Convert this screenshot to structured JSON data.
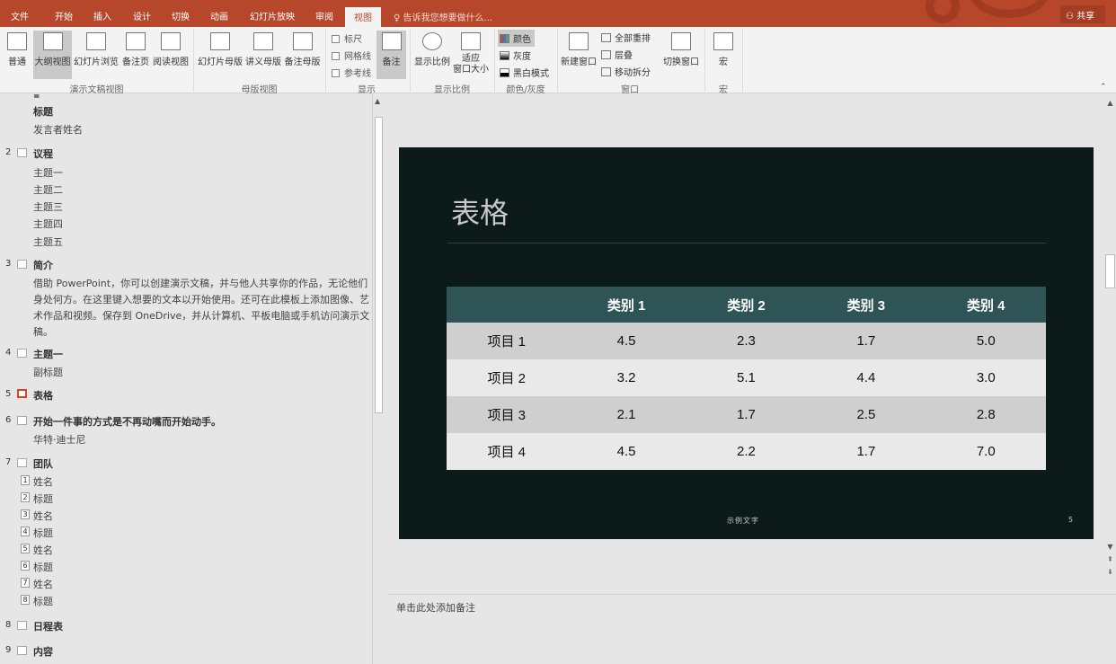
{
  "tabs": [
    "文件",
    "开始",
    "插入",
    "设计",
    "切换",
    "动画",
    "幻灯片放映",
    "审阅",
    "视图"
  ],
  "active_tab": "视图",
  "tell_me": "告诉我您想要做什么...",
  "share": "共享",
  "ribbon": {
    "presentation_views": {
      "normal": "普通",
      "outline": "大纲视图",
      "sorter": "幻灯片浏览",
      "notes_page": "备注页",
      "reading": "阅读视图",
      "group": "演示文稿视图"
    },
    "master_views": {
      "slide_master": "幻灯片母版",
      "handout_master": "讲义母版",
      "notes_master": "备注母版",
      "group": "母版视图"
    },
    "show": {
      "ruler": "标尺",
      "gridlines": "网格线",
      "guides": "参考线",
      "notes": "备注",
      "group": "显示"
    },
    "zoom": {
      "zoom": "显示比例",
      "fit_line1": "适应",
      "fit_line2": "窗口大小",
      "group": "显示比例"
    },
    "color": {
      "color": "颜色",
      "grayscale": "灰度",
      "bw": "黑白模式",
      "group": "颜色/灰度"
    },
    "window": {
      "new_window": "新建窗口",
      "arrange_all": "全部重排",
      "cascade": "层叠",
      "move_split": "移动拆分",
      "switch": "切换窗口",
      "group": "窗口"
    },
    "macros": {
      "macros": "宏",
      "group": "宏"
    }
  },
  "outline": {
    "s1": {
      "title": "标题",
      "sub": "发言者姓名"
    },
    "s2": {
      "num": "2",
      "title": "议程",
      "items": [
        "主题一",
        "主题二",
        "主题三",
        "主题四",
        "主题五"
      ]
    },
    "s3": {
      "num": "3",
      "title": "简介",
      "lines": [
        "借助 PowerPoint，你可以创建演示文稿，并与他人共享你的作品，无论他们",
        "身处何方。在这里键入想要的文本以开始使用。还可在此模板上添加图像、艺",
        "术作品和视频。保存到 OneDrive，并从计算机、平板电脑或手机访问演示文",
        "稿。"
      ]
    },
    "s4": {
      "num": "4",
      "title": "主题一",
      "sub": "副标题"
    },
    "s5": {
      "num": "5",
      "title": "表格"
    },
    "s6": {
      "num": "6",
      "title": "开始一件事的方式是不再动嘴而开始动手。",
      "sub": "华特·迪士尼"
    },
    "s7": {
      "num": "7",
      "title": "团队",
      "items": [
        {
          "n": "1",
          "t": "姓名"
        },
        {
          "n": "2",
          "t": "标题"
        },
        {
          "n": "3",
          "t": "姓名"
        },
        {
          "n": "4",
          "t": "标题"
        },
        {
          "n": "5",
          "t": "姓名"
        },
        {
          "n": "6",
          "t": "标题"
        },
        {
          "n": "7",
          "t": "姓名"
        },
        {
          "n": "8",
          "t": "标题"
        }
      ]
    },
    "s8": {
      "num": "8",
      "title": "日程表"
    },
    "s9": {
      "num": "9",
      "title": "内容"
    }
  },
  "slide": {
    "title": "表格",
    "headers": [
      "",
      "类别 1",
      "类别 2",
      "类别 3",
      "类别 4"
    ],
    "rows": [
      [
        "项目 1",
        "4.5",
        "2.3",
        "1.7",
        "5.0"
      ],
      [
        "项目 2",
        "3.2",
        "5.1",
        "4.4",
        "3.0"
      ],
      [
        "项目 3",
        "2.1",
        "1.7",
        "2.5",
        "2.8"
      ],
      [
        "项目 4",
        "4.5",
        "2.2",
        "1.7",
        "7.0"
      ]
    ],
    "footer": "示例文字",
    "number": "5"
  },
  "notes_placeholder": "单击此处添加备注",
  "colors": {
    "accent": "#b7472a",
    "slide_bg": "#0d1a1a",
    "table_header": "#2f5456"
  }
}
